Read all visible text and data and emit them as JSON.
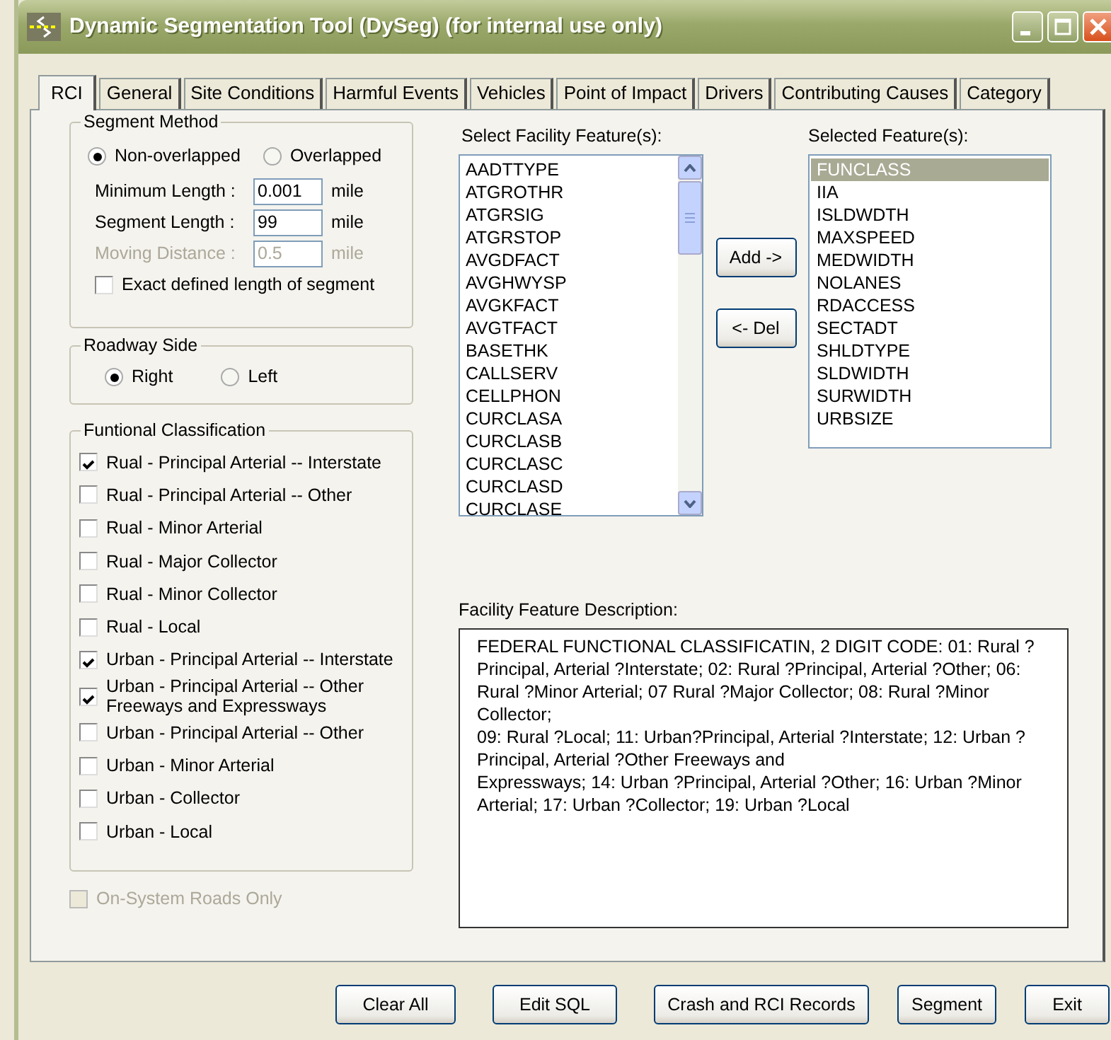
{
  "window": {
    "title": "Dynamic Segmentation Tool (DySeg) (for internal use only)"
  },
  "tabs": [
    {
      "label": "RCI",
      "selected": true
    },
    {
      "label": "General",
      "selected": false
    },
    {
      "label": "Site Conditions",
      "selected": false
    },
    {
      "label": "Harmful Events",
      "selected": false
    },
    {
      "label": "Vehicles",
      "selected": false
    },
    {
      "label": "Point of Impact",
      "selected": false
    },
    {
      "label": "Drivers",
      "selected": false
    },
    {
      "label": "Contributing Causes",
      "selected": false
    },
    {
      "label": "Category",
      "selected": false
    }
  ],
  "segment_method": {
    "title": "Segment Method",
    "options": [
      {
        "label": "Non-overlapped",
        "selected": true
      },
      {
        "label": "Overlapped",
        "selected": false
      }
    ],
    "fields": [
      {
        "label": "Minimum Length :",
        "value": "0.001",
        "unit": "mile",
        "disabled": false
      },
      {
        "label": "Segment Length :",
        "value": "99",
        "unit": "mile",
        "disabled": false
      },
      {
        "label": "Moving Distance :",
        "value": "0.5",
        "unit": "mile",
        "disabled": true
      }
    ],
    "exact_length": {
      "label": "Exact defined length of segment",
      "checked": false
    }
  },
  "roadway_side": {
    "title": "Roadway Side",
    "options": [
      {
        "label": "Right",
        "selected": true
      },
      {
        "label": "Left",
        "selected": false
      }
    ]
  },
  "functional_classification": {
    "title": "Funtional Classification",
    "items": [
      {
        "label": "Rual - Principal Arterial -- Interstate",
        "checked": true
      },
      {
        "label": "Rual - Principal Arterial -- Other",
        "checked": false
      },
      {
        "label": "Rual - Minor Arterial",
        "checked": false
      },
      {
        "label": "Rual - Major Collector",
        "checked": false
      },
      {
        "label": "Rual - Minor Collector",
        "checked": false
      },
      {
        "label": "Rual - Local",
        "checked": false
      },
      {
        "label": "Urban - Principal Arterial -- Interstate",
        "checked": true
      },
      {
        "label": "Urban - Principal Arterial -- Other Freeways and Expressways",
        "checked": true
      },
      {
        "label": "Urban - Principal Arterial -- Other",
        "checked": false
      },
      {
        "label": "Urban - Minor Arterial",
        "checked": false
      },
      {
        "label": "Urban - Collector",
        "checked": false
      },
      {
        "label": "Urban - Local",
        "checked": false
      }
    ]
  },
  "on_system": {
    "label": "On-System Roads Only",
    "checked": false,
    "disabled": true
  },
  "facility_features": {
    "label": "Select Facility Feature(s):",
    "items": [
      "AADTTYPE",
      "ATGROTHR",
      "ATGRSIG",
      "ATGRSTOP",
      "AVGDFACT",
      "AVGHWYSP",
      "AVGKFACT",
      "AVGTFACT",
      "BASETHK",
      "CALLSERV",
      "CELLPHON",
      "CURCLASA",
      "CURCLASB",
      "CURCLASC",
      "CURCLASD",
      "CURCLASE"
    ]
  },
  "add_button": "Add ->",
  "del_button": "<- Del",
  "selected_features": {
    "label": "Selected Feature(s):",
    "items": [
      {
        "label": "FUNCLASS",
        "selected": true
      },
      {
        "label": "IIA",
        "selected": false
      },
      {
        "label": "ISLDWDTH",
        "selected": false
      },
      {
        "label": "MAXSPEED",
        "selected": false
      },
      {
        "label": "MEDWIDTH",
        "selected": false
      },
      {
        "label": "NOLANES",
        "selected": false
      },
      {
        "label": "RDACCESS",
        "selected": false
      },
      {
        "label": "SECTADT",
        "selected": false
      },
      {
        "label": "SHLDTYPE",
        "selected": false
      },
      {
        "label": "SLDWIDTH",
        "selected": false
      },
      {
        "label": "SURWIDTH",
        "selected": false
      },
      {
        "label": "URBSIZE",
        "selected": false
      }
    ]
  },
  "description": {
    "label": "Facility Feature Description:",
    "text": "FEDERAL FUNCTIONAL CLASSIFICATIN, 2 DIGIT CODE:  01: Rural ?Principal, Arterial ?Interstate; 02: Rural ?Principal, Arterial ?Other; 06: Rural ?Minor Arterial; 07 Rural ?Major Collector; 08: Rural ?Minor Collector;\n09: Rural ?Local; 11: Urban?Principal, Arterial ?Interstate; 12: Urban ?Principal, Arterial ?Other Freeways and\nExpressways; 14: Urban ?Principal, Arterial ?Other; 16: Urban ?Minor Arterial; 17: Urban ?Collector; 19: Urban ?Local"
  },
  "buttons": [
    "Clear All",
    "Edit SQL",
    "Crash and RCI Records",
    "Segment",
    "Exit"
  ]
}
